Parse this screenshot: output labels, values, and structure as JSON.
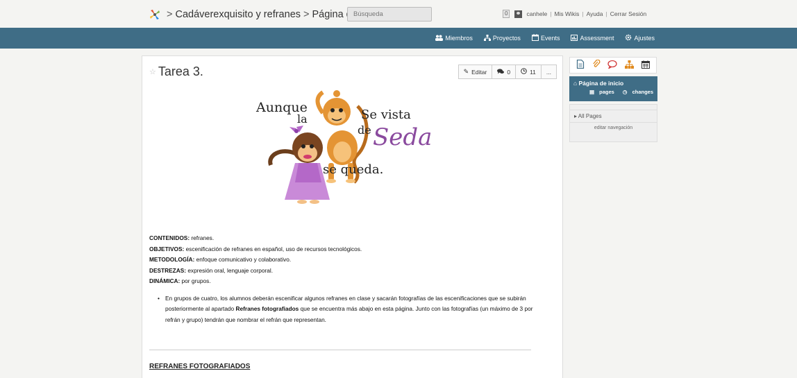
{
  "header": {
    "breadcrumb": [
      "Cadáverexquisito y refranes",
      "Página de inicio"
    ],
    "breadcrumb_separator": ">",
    "search_placeholder": "Búsqueda",
    "notification_count": "0",
    "user": "canhele",
    "links": [
      "Mis Wikis",
      "Ayuda",
      "Cerrar Sesión"
    ]
  },
  "nav": {
    "items": [
      {
        "icon": "members-icon",
        "label": "Miembros"
      },
      {
        "icon": "projects-icon",
        "label": "Proyectos"
      },
      {
        "icon": "calendar-icon",
        "label": "Events"
      },
      {
        "icon": "assessment-icon",
        "label": "Assessment"
      },
      {
        "icon": "gear-icon",
        "label": "Ajustes"
      }
    ]
  },
  "page": {
    "title": "Tarea 3.",
    "buttons": {
      "edit": "Editar",
      "comments": "0",
      "history": "11",
      "more": "..."
    },
    "illustration": {
      "words": [
        "Aunque",
        "la",
        "Se vista",
        "de",
        "Seda",
        "se queda."
      ]
    },
    "details": [
      {
        "label": "CONTENIDOS:",
        "text": " refranes."
      },
      {
        "label": "OBJETIVOS:",
        "text": " escenificación de refranes en español, uso de recursos tecnológicos."
      },
      {
        "label": "METODOLOGÍA:",
        "text": " enfoque comunicativo y colaborativo."
      },
      {
        "label": "DESTREZAS:",
        "text": " expresión oral, lenguaje corporal."
      },
      {
        "label": "DINÁMICA:",
        "text": " por grupos."
      }
    ],
    "bullet": {
      "part1": "En grupos de cuatro, los alumnos deberán escenificar algunos refranes en clase y sacarán fotografías de las escenificaciones que se subirán posteriormente al apartado ",
      "bold": "Refranes fotografiados",
      "part2": " que se encuentra más abajo en esta página. Junto con las fotografías (un máximo de 3 por refrán y grupo) tendrán que nombrar el refrán que representan."
    },
    "section_heading": "REFRANES FOTOGRAFIADOS"
  },
  "sidebar": {
    "tools": [
      "page-icon",
      "attachment-icon",
      "comment-icon",
      "hierarchy-icon",
      "calendar-icon"
    ],
    "current_page": "Página de inicio",
    "current_links": [
      "pages",
      "changes"
    ],
    "nav_item": "All Pages",
    "edit_nav": "editar navegación"
  },
  "colors": {
    "nav_bg": "#3f6d86",
    "accent_orange": "#e08a1e",
    "text_purple": "#8a4a9e"
  }
}
